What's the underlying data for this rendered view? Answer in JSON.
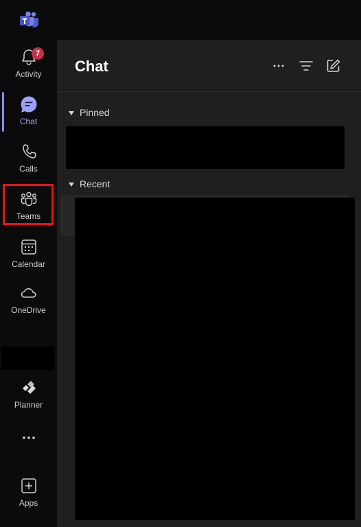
{
  "app": {
    "logo_icon": "microsoft-teams-logo-icon"
  },
  "rail": {
    "items": [
      {
        "key": "activity",
        "label": "Activity",
        "icon": "bell-icon",
        "badge": "7"
      },
      {
        "key": "chat",
        "label": "Chat",
        "icon": "chat-bubble-icon",
        "active": true
      },
      {
        "key": "calls",
        "label": "Calls",
        "icon": "phone-icon"
      },
      {
        "key": "teams",
        "label": "Teams",
        "icon": "people-group-icon",
        "highlighted": true
      },
      {
        "key": "calendar",
        "label": "Calendar",
        "icon": "calendar-icon"
      },
      {
        "key": "onedrive",
        "label": "OneDrive",
        "icon": "cloud-icon"
      },
      {
        "key": "planner",
        "label": "Planner",
        "icon": "planner-icon"
      },
      {
        "key": "more",
        "label": "",
        "icon": "more-horizontal-icon"
      },
      {
        "key": "apps",
        "label": "Apps",
        "icon": "add-square-icon"
      }
    ],
    "accent_color": "#8b8cf6",
    "highlight_color": "#e81123",
    "badge_color": "#c4314b"
  },
  "panel": {
    "title": "Chat",
    "header_icons": [
      "more-options-icon",
      "filter-icon",
      "new-chat-icon"
    ],
    "sections": [
      {
        "label": "Pinned",
        "icon": "caret-down-icon"
      },
      {
        "label": "Recent",
        "icon": "caret-down-icon"
      }
    ]
  }
}
